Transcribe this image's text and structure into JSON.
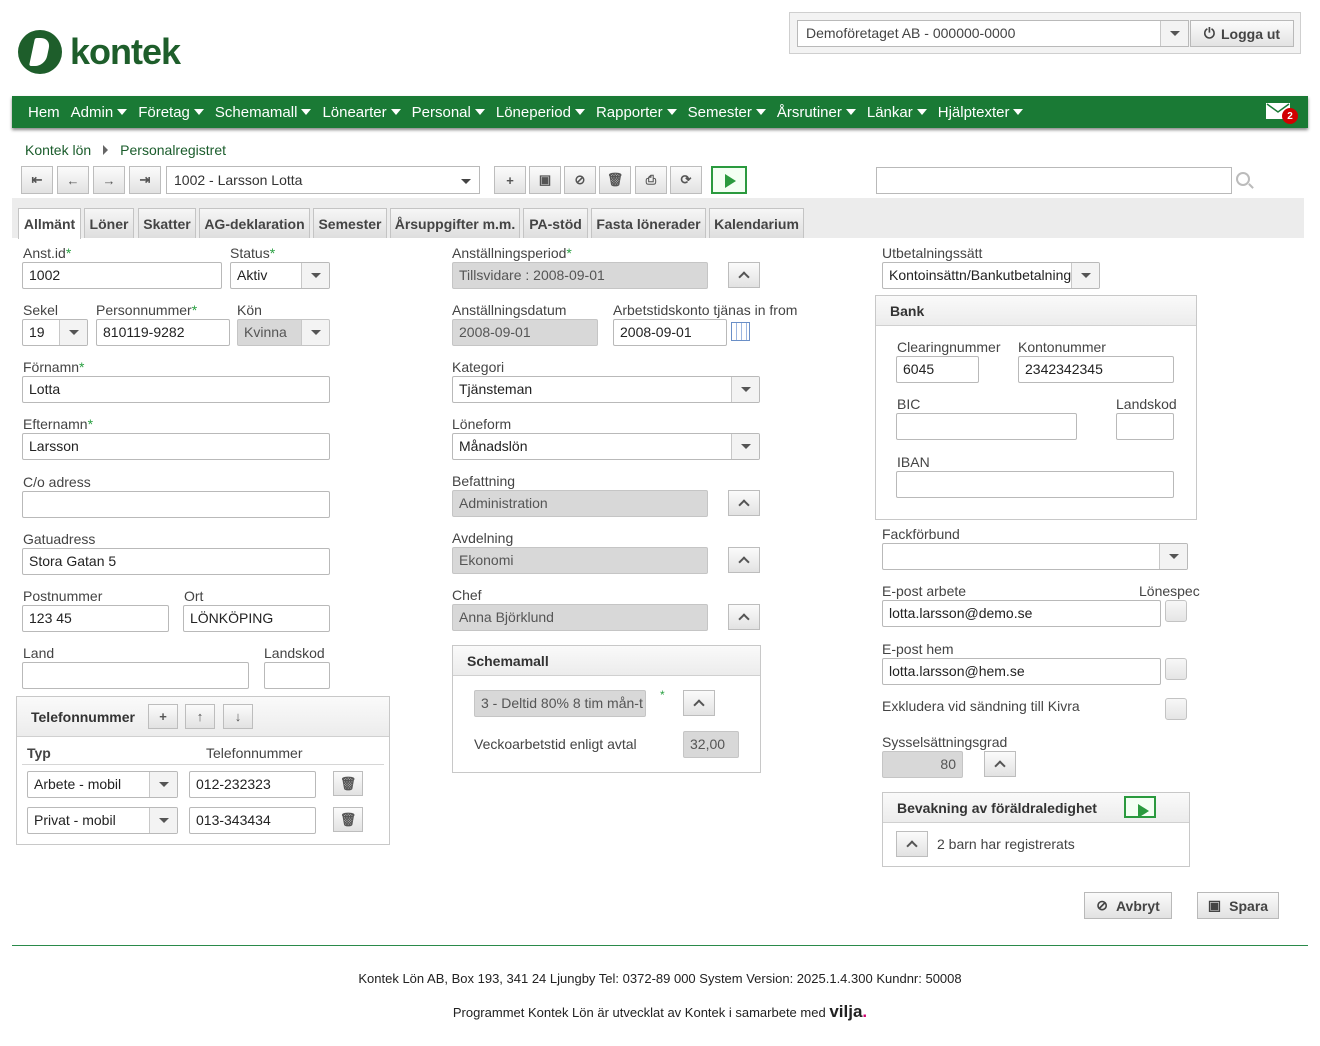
{
  "brand": {
    "logo_text": "kontek"
  },
  "company": {
    "selected": "Demoföretaget AB - 000000-0000",
    "logout_label": "Logga ut"
  },
  "nav": {
    "items": [
      "Hem",
      "Admin",
      "Företag",
      "Schemamall",
      "Lönearter",
      "Personal",
      "Löneperiod",
      "Rapporter",
      "Semester",
      "Årsrutiner",
      "Länkar",
      "Hjälptexter"
    ],
    "mail_count": "2"
  },
  "breadcrumb": [
    "Kontek lön",
    "Personalregistret"
  ],
  "toolbar": {
    "person": "1002 - Larsson Lotta",
    "search_value": ""
  },
  "tabs": [
    "Allmänt",
    "Löner",
    "Skatter",
    "AG-deklaration",
    "Semester",
    "Årsuppgifter m.m.",
    "PA-stöd",
    "Fasta lönerader",
    "Kalendarium"
  ],
  "left": {
    "anst_id_label": "Anst.id",
    "anst_id": "1002",
    "status_label": "Status",
    "status": "Aktiv",
    "sekel_label": "Sekel",
    "sekel": "19",
    "personnummer_label": "Personnummer",
    "personnummer": "810119-9282",
    "kon_label": "Kön",
    "kon": "Kvinna",
    "fornamn_label": "Förnamn",
    "fornamn": "Lotta",
    "efternamn_label": "Efternamn",
    "efternamn": "Larsson",
    "co_label": "C/o adress",
    "co": "",
    "gatuadress_label": "Gatuadress",
    "gatuadress": "Stora Gatan 5",
    "postnummer_label": "Postnummer",
    "postnummer": "123 45",
    "ort_label": "Ort",
    "ort": "LÖNKÖPING",
    "land_label": "Land",
    "land": "",
    "landskod_label": "Landskod",
    "landskod": ""
  },
  "phones": {
    "title": "Telefonnummer",
    "col_typ": "Typ",
    "col_nummer": "Telefonnummer",
    "rows": [
      {
        "typ": "Arbete - mobil",
        "nummer": "012-232323"
      },
      {
        "typ": "Privat - mobil",
        "nummer": "013-343434"
      }
    ]
  },
  "middle": {
    "period_label": "Anställningsperiod",
    "period": "Tillsvidare : 2008-09-01",
    "anst_datum_label": "Anställningsdatum",
    "anst_datum": "2008-09-01",
    "atk_label": "Arbetstidskonto tjänas in from",
    "atk": "2008-09-01",
    "kategori_label": "Kategori",
    "kategori": "Tjänsteman",
    "loneform_label": "Löneform",
    "loneform": "Månadslön",
    "befattning_label": "Befattning",
    "befattning": "Administration",
    "avdelning_label": "Avdelning",
    "avdelning": "Ekonomi",
    "chef_label": "Chef",
    "chef": "Anna Björklund"
  },
  "schemamall": {
    "title": "Schemamall",
    "value": "3 - Deltid 80% 8 tim mån-t",
    "vecka_label": "Veckoarbetstid enligt avtal",
    "vecka": "32,00"
  },
  "right": {
    "utbetalning_label": "Utbetalningssätt",
    "utbetalning": "Kontoinsättn/Bankutbetalning",
    "fackforbund_label": "Fackförbund",
    "fackforbund": "",
    "epost_arbete_label": "E-post arbete",
    "epost_arbete": "lotta.larsson@demo.se",
    "lonespec_label": "Lönespec",
    "epost_hem_label": "E-post hem",
    "epost_hem": "lotta.larsson@hem.se",
    "exkludera_label": "Exkludera vid sändning till Kivra",
    "syssel_label": "Sysselsättningsgrad",
    "syssel": "80"
  },
  "bank": {
    "title": "Bank",
    "clearing_label": "Clearingnummer",
    "clearing": "6045",
    "konto_label": "Kontonummer",
    "konto": "2342342345",
    "bic_label": "BIC",
    "bic": "",
    "landskod_label": "Landskod",
    "landskod": "",
    "iban_label": "IBAN",
    "iban": ""
  },
  "foraldra": {
    "title": "Bevakning av föräldraledighet",
    "text": "2 barn har registrerats"
  },
  "actions": {
    "cancel": "Avbryt",
    "save": "Spara"
  },
  "footer": {
    "line1": "Kontek Lön AB, Box 193, 341 24 Ljungby Tel: 0372-89 000 System Version: 2025.1.4.300 Kundnr: 50008",
    "line2": "Programmet Kontek Lön är utvecklat av Kontek i samarbete med",
    "partner": "vilja"
  }
}
